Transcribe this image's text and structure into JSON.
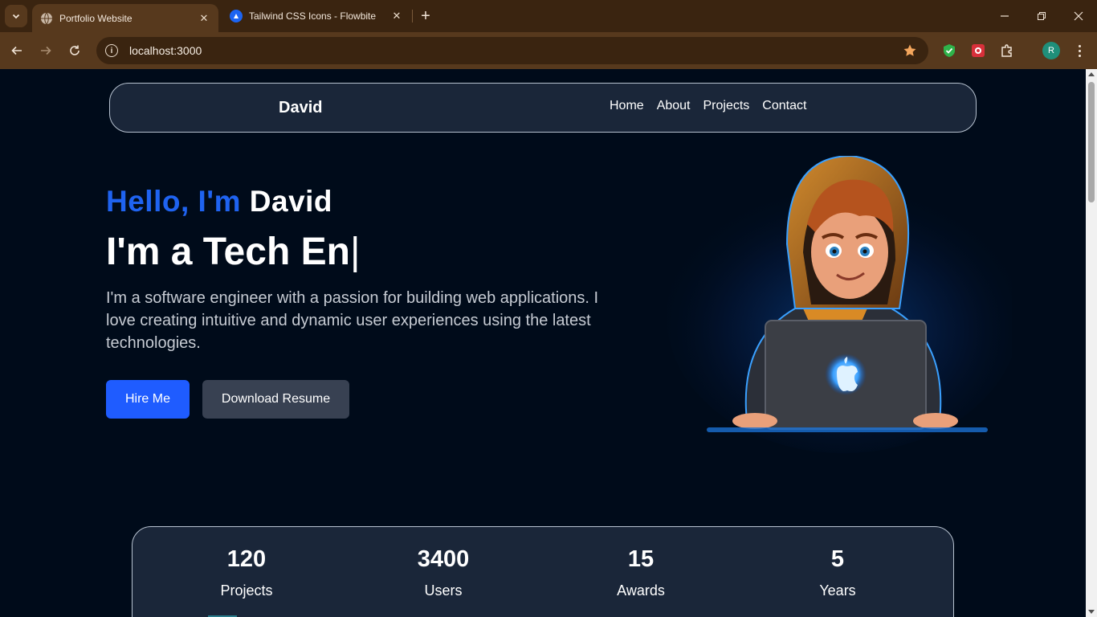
{
  "browser": {
    "tabs": [
      {
        "title": "Portfolio Website",
        "active": true
      },
      {
        "title": "Tailwind CSS Icons - Flowbite",
        "active": false
      }
    ],
    "url": "localhost:3000",
    "profile_initial": "R"
  },
  "site": {
    "brand": "David",
    "nav": [
      "Home",
      "About",
      "Projects",
      "Contact"
    ],
    "hero": {
      "greeting": "Hello, I'm",
      "name": "David",
      "typed_text": "I'm a Tech En",
      "caret": "|",
      "bio": "I'm a software engineer with a passion for building web applications. I love creating intuitive and dynamic user experiences using the latest technologies.",
      "hire_label": "Hire Me",
      "resume_label": "Download Resume"
    },
    "stats": [
      {
        "value": "120",
        "label": "Projects"
      },
      {
        "value": "3400",
        "label": "Users"
      },
      {
        "value": "15",
        "label": "Awards"
      },
      {
        "value": "5",
        "label": "Years"
      }
    ]
  },
  "colors": {
    "accent_blue": "#1f63f0",
    "button_blue": "#1f5cff",
    "page_bg": "#000b1a",
    "card_bg": "#1a2639",
    "chrome_brown": "#57391d"
  },
  "icons": [
    "tab-list-icon",
    "globe-icon",
    "flowbite-icon",
    "close-icon",
    "plus-icon",
    "minimize-icon",
    "restore-icon",
    "back-icon",
    "forward-icon",
    "reload-icon",
    "info-icon",
    "star-icon",
    "shield-extension-icon",
    "extension-icon",
    "puzzle-icon",
    "kebab-icon"
  ]
}
